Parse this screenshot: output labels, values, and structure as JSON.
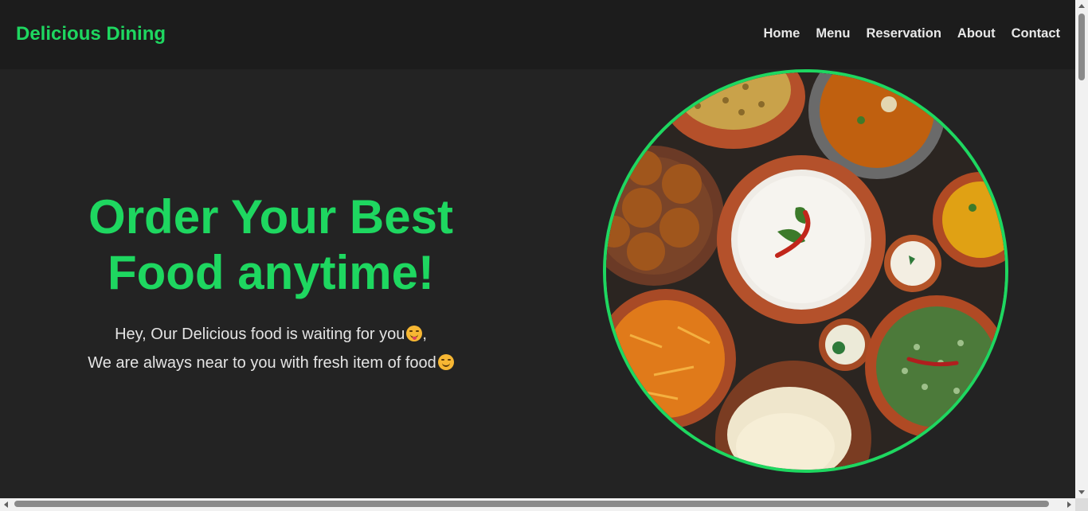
{
  "brand": {
    "name": "Delicious Dining",
    "accent": "#1ed760"
  },
  "nav": {
    "items": [
      {
        "label": "Home"
      },
      {
        "label": "Menu"
      },
      {
        "label": "Reservation"
      },
      {
        "label": "About"
      },
      {
        "label": "Contact"
      }
    ]
  },
  "hero": {
    "title_line1": "Order Your Best",
    "title_line2": "Food anytime!",
    "sub_line1": "Hey, Our Delicious food is waiting for you",
    "sub_line1_suffix": ",",
    "sub_line2": "We are always near to you with fresh item of food",
    "emoji1": "face-savoring-food-icon",
    "emoji2": "smiling-face-icon",
    "image": "indian-thali-food-image"
  },
  "colors": {
    "background": "#232323",
    "header": "#1c1c1c",
    "text": "#e4e4e4"
  }
}
